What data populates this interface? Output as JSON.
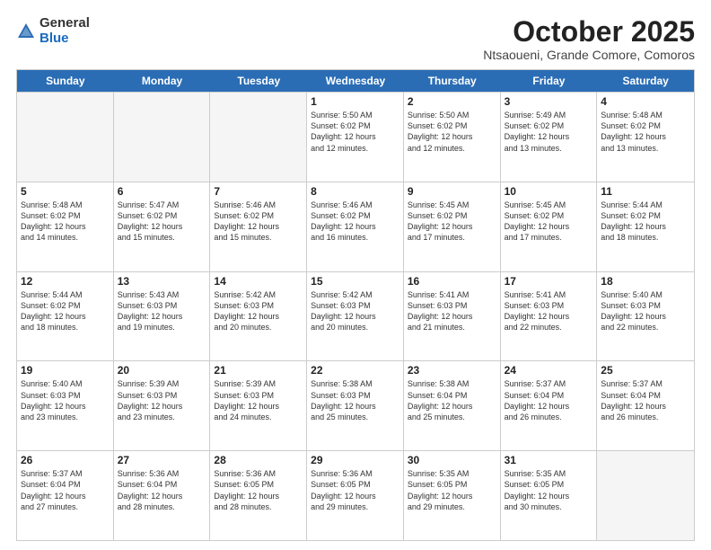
{
  "logo": {
    "general": "General",
    "blue": "Blue"
  },
  "header": {
    "month": "October 2025",
    "location": "Ntsaoueni, Grande Comore, Comoros"
  },
  "days": [
    "Sunday",
    "Monday",
    "Tuesday",
    "Wednesday",
    "Thursday",
    "Friday",
    "Saturday"
  ],
  "rows": [
    [
      {
        "day": "",
        "info": "",
        "empty": true
      },
      {
        "day": "",
        "info": "",
        "empty": true
      },
      {
        "day": "",
        "info": "",
        "empty": true
      },
      {
        "day": "1",
        "info": "Sunrise: 5:50 AM\nSunset: 6:02 PM\nDaylight: 12 hours\nand 12 minutes."
      },
      {
        "day": "2",
        "info": "Sunrise: 5:50 AM\nSunset: 6:02 PM\nDaylight: 12 hours\nand 12 minutes."
      },
      {
        "day": "3",
        "info": "Sunrise: 5:49 AM\nSunset: 6:02 PM\nDaylight: 12 hours\nand 13 minutes."
      },
      {
        "day": "4",
        "info": "Sunrise: 5:48 AM\nSunset: 6:02 PM\nDaylight: 12 hours\nand 13 minutes."
      }
    ],
    [
      {
        "day": "5",
        "info": "Sunrise: 5:48 AM\nSunset: 6:02 PM\nDaylight: 12 hours\nand 14 minutes."
      },
      {
        "day": "6",
        "info": "Sunrise: 5:47 AM\nSunset: 6:02 PM\nDaylight: 12 hours\nand 15 minutes."
      },
      {
        "day": "7",
        "info": "Sunrise: 5:46 AM\nSunset: 6:02 PM\nDaylight: 12 hours\nand 15 minutes."
      },
      {
        "day": "8",
        "info": "Sunrise: 5:46 AM\nSunset: 6:02 PM\nDaylight: 12 hours\nand 16 minutes."
      },
      {
        "day": "9",
        "info": "Sunrise: 5:45 AM\nSunset: 6:02 PM\nDaylight: 12 hours\nand 17 minutes."
      },
      {
        "day": "10",
        "info": "Sunrise: 5:45 AM\nSunset: 6:02 PM\nDaylight: 12 hours\nand 17 minutes."
      },
      {
        "day": "11",
        "info": "Sunrise: 5:44 AM\nSunset: 6:02 PM\nDaylight: 12 hours\nand 18 minutes."
      }
    ],
    [
      {
        "day": "12",
        "info": "Sunrise: 5:44 AM\nSunset: 6:02 PM\nDaylight: 12 hours\nand 18 minutes."
      },
      {
        "day": "13",
        "info": "Sunrise: 5:43 AM\nSunset: 6:03 PM\nDaylight: 12 hours\nand 19 minutes."
      },
      {
        "day": "14",
        "info": "Sunrise: 5:42 AM\nSunset: 6:03 PM\nDaylight: 12 hours\nand 20 minutes."
      },
      {
        "day": "15",
        "info": "Sunrise: 5:42 AM\nSunset: 6:03 PM\nDaylight: 12 hours\nand 20 minutes."
      },
      {
        "day": "16",
        "info": "Sunrise: 5:41 AM\nSunset: 6:03 PM\nDaylight: 12 hours\nand 21 minutes."
      },
      {
        "day": "17",
        "info": "Sunrise: 5:41 AM\nSunset: 6:03 PM\nDaylight: 12 hours\nand 22 minutes."
      },
      {
        "day": "18",
        "info": "Sunrise: 5:40 AM\nSunset: 6:03 PM\nDaylight: 12 hours\nand 22 minutes."
      }
    ],
    [
      {
        "day": "19",
        "info": "Sunrise: 5:40 AM\nSunset: 6:03 PM\nDaylight: 12 hours\nand 23 minutes."
      },
      {
        "day": "20",
        "info": "Sunrise: 5:39 AM\nSunset: 6:03 PM\nDaylight: 12 hours\nand 23 minutes."
      },
      {
        "day": "21",
        "info": "Sunrise: 5:39 AM\nSunset: 6:03 PM\nDaylight: 12 hours\nand 24 minutes."
      },
      {
        "day": "22",
        "info": "Sunrise: 5:38 AM\nSunset: 6:03 PM\nDaylight: 12 hours\nand 25 minutes."
      },
      {
        "day": "23",
        "info": "Sunrise: 5:38 AM\nSunset: 6:04 PM\nDaylight: 12 hours\nand 25 minutes."
      },
      {
        "day": "24",
        "info": "Sunrise: 5:37 AM\nSunset: 6:04 PM\nDaylight: 12 hours\nand 26 minutes."
      },
      {
        "day": "25",
        "info": "Sunrise: 5:37 AM\nSunset: 6:04 PM\nDaylight: 12 hours\nand 26 minutes."
      }
    ],
    [
      {
        "day": "26",
        "info": "Sunrise: 5:37 AM\nSunset: 6:04 PM\nDaylight: 12 hours\nand 27 minutes."
      },
      {
        "day": "27",
        "info": "Sunrise: 5:36 AM\nSunset: 6:04 PM\nDaylight: 12 hours\nand 28 minutes."
      },
      {
        "day": "28",
        "info": "Sunrise: 5:36 AM\nSunset: 6:05 PM\nDaylight: 12 hours\nand 28 minutes."
      },
      {
        "day": "29",
        "info": "Sunrise: 5:36 AM\nSunset: 6:05 PM\nDaylight: 12 hours\nand 29 minutes."
      },
      {
        "day": "30",
        "info": "Sunrise: 5:35 AM\nSunset: 6:05 PM\nDaylight: 12 hours\nand 29 minutes."
      },
      {
        "day": "31",
        "info": "Sunrise: 5:35 AM\nSunset: 6:05 PM\nDaylight: 12 hours\nand 30 minutes."
      },
      {
        "day": "",
        "info": "",
        "empty": true
      }
    ]
  ]
}
